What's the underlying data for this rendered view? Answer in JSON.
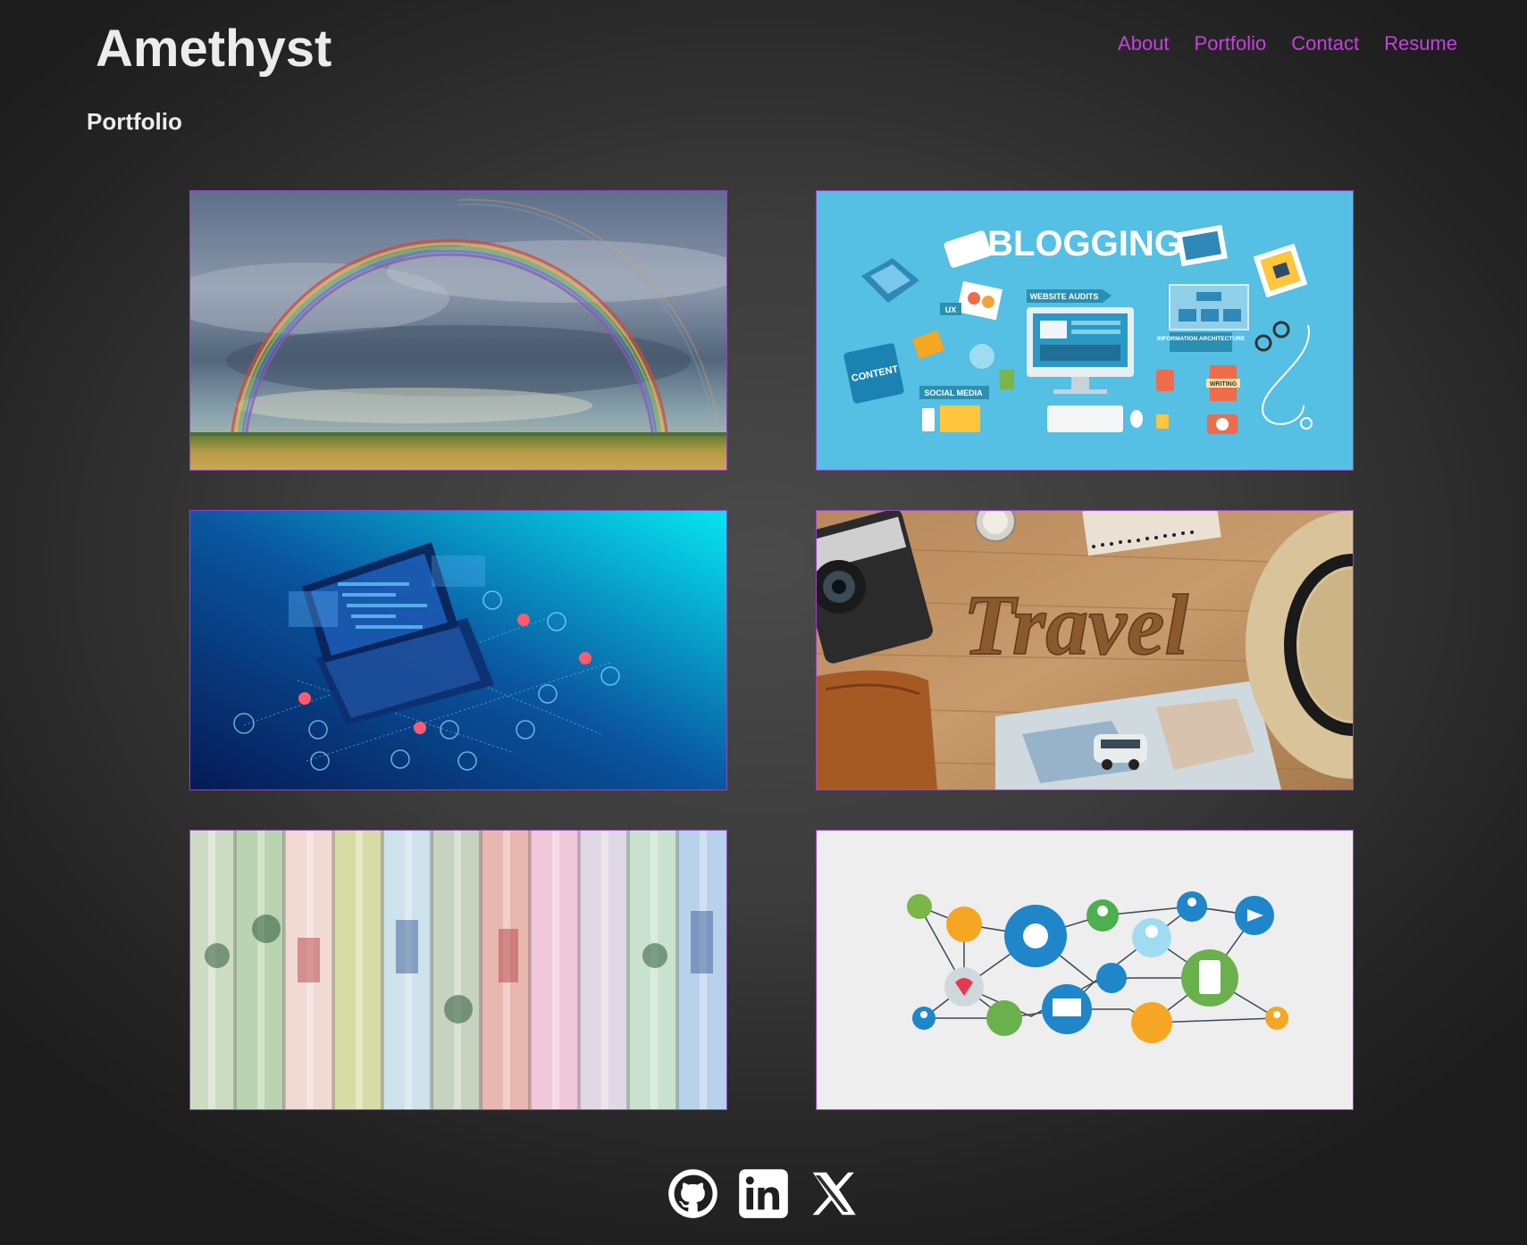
{
  "header": {
    "site_title": "Amethyst",
    "nav": [
      {
        "label": "About"
      },
      {
        "label": "Portfolio"
      },
      {
        "label": "Contact"
      },
      {
        "label": "Resume"
      }
    ]
  },
  "main": {
    "section_title": "Portfolio",
    "projects": [
      {
        "image": "rainbow-landscape",
        "text": ""
      },
      {
        "image": "blogging-illustration",
        "text": "BLOGGING",
        "labels": [
          "WEBSITE AUDITS",
          "UX",
          "CONTENT",
          "SOCIAL MEDIA",
          "INFORMATION ARCHITECTURE",
          "WRITING"
        ]
      },
      {
        "image": "laptop-code-illustration",
        "text": ""
      },
      {
        "image": "travel-flatlay",
        "text": "Travel"
      },
      {
        "image": "rolled-banknotes",
        "text": ""
      },
      {
        "image": "social-network-illustration",
        "text": ""
      }
    ]
  },
  "footer": {
    "socials": [
      {
        "icon": "github-icon"
      },
      {
        "icon": "linkedin-icon"
      },
      {
        "icon": "x-icon"
      }
    ]
  },
  "colors": {
    "accent": "#c93fe0",
    "card_border": "#9b3fcf",
    "text": "#ececec",
    "background": "#3c3c3c"
  }
}
